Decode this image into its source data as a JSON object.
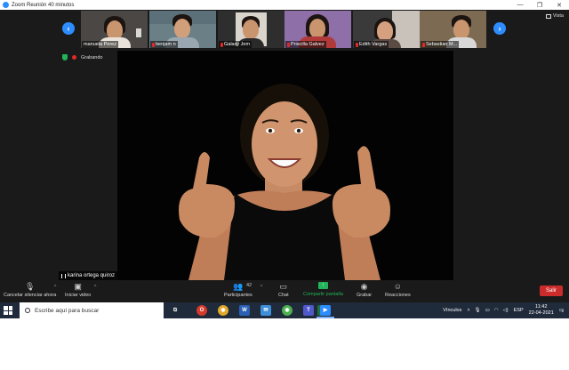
{
  "window": {
    "title": "Zoom Reunión 40 minutos",
    "minimize_glyph": "—",
    "maximize_glyph": "❐",
    "close_glyph": "✕"
  },
  "gallery": {
    "view_label": "Vista",
    "left_arrow": "‹",
    "right_arrow": "›",
    "participants": [
      {
        "name": "manuela Perez"
      },
      {
        "name": "benjam n"
      },
      {
        "name": "Galaxy Jem"
      },
      {
        "name": "Priscilla Galvez"
      },
      {
        "name": "Edith Vargas"
      },
      {
        "name": "Sebastian M..."
      }
    ]
  },
  "recording": {
    "label": "Grabando"
  },
  "speaker": {
    "name": "karina ortega quiroz"
  },
  "toolbar": {
    "unmute_label": "Cancelar silenciar ahora",
    "video_label": "Iniciar video",
    "participants_label": "Participantes",
    "participants_count": "42",
    "chat_label": "Chat",
    "share_label": "Compartir pantalla",
    "record_label": "Grabar",
    "reactions_label": "Reacciones",
    "leave_label": "Salir",
    "caret": "^"
  },
  "taskbar": {
    "search_placeholder": "Escribe aquí para buscar",
    "links_label": "Vínculos",
    "language": "ESP",
    "time": "11:42",
    "date": "22-04-2021",
    "notification_count": "2",
    "apps": [
      {
        "icon": "task-view-icon",
        "glyph": "⧉"
      },
      {
        "icon": "opera-icon",
        "glyph": "O"
      },
      {
        "icon": "chrome-icon",
        "glyph": "◉"
      },
      {
        "icon": "word-icon",
        "glyph": "W"
      },
      {
        "icon": "mail-icon",
        "glyph": "✉"
      },
      {
        "icon": "chrome-alt-icon",
        "glyph": "◉"
      },
      {
        "icon": "teams-icon",
        "glyph": "T"
      },
      {
        "icon": "excel-icon",
        "glyph": "X"
      },
      {
        "icon": "zoom-icon",
        "glyph": "▶"
      }
    ]
  },
  "colors": {
    "zoom_blue": "#2d8cff",
    "share_green": "#23b35a",
    "leave_red": "#cc2b2b",
    "taskbar_bg": "#1f2a3a"
  }
}
